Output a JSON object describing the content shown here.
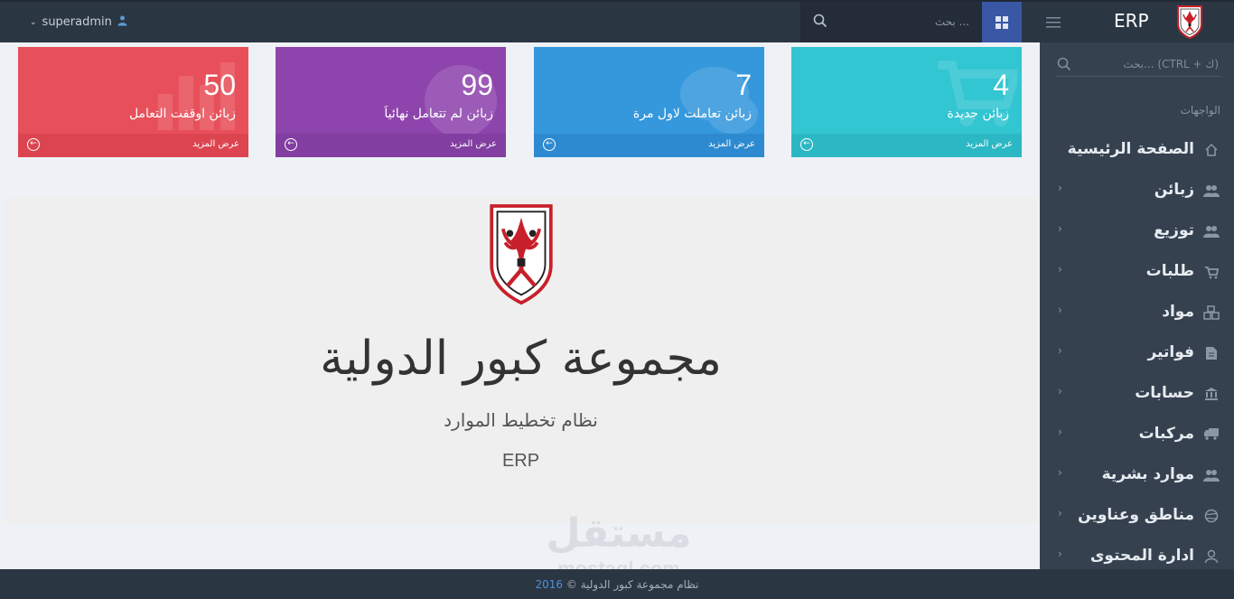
{
  "header": {
    "brand": "ERP",
    "user": "superadmin",
    "search_placeholder": "بحث ..."
  },
  "sidebar": {
    "search_placeholder": "بحث... (CTRL + ك)",
    "heading": "الواجهات",
    "items": [
      {
        "label": "الصفحة الرئيسية",
        "icon": "home-icon",
        "has_arrow": false
      },
      {
        "label": "زبائن",
        "icon": "users-icon",
        "has_arrow": true
      },
      {
        "label": "توزيع",
        "icon": "users-icon",
        "has_arrow": true
      },
      {
        "label": "طلبات",
        "icon": "cart-icon",
        "has_arrow": true
      },
      {
        "label": "مواد",
        "icon": "cubes-icon",
        "has_arrow": true
      },
      {
        "label": "فواتير",
        "icon": "file-icon",
        "has_arrow": true
      },
      {
        "label": "حسابات",
        "icon": "bank-icon",
        "has_arrow": true
      },
      {
        "label": "مركبات",
        "icon": "truck-icon",
        "has_arrow": true
      },
      {
        "label": "موارد بشرية",
        "icon": "users-icon",
        "has_arrow": true
      },
      {
        "label": "مناطق وعناوين",
        "icon": "globe-icon",
        "has_arrow": true
      },
      {
        "label": "ادارة المحتوى",
        "icon": "user-icon",
        "has_arrow": true
      }
    ]
  },
  "tiles": [
    {
      "number": "4",
      "label": "زبائن جديدة",
      "more": "عرض المزيد",
      "color": "#32c5d2"
    },
    {
      "number": "7",
      "label": "زبائن تعاملت لاول مرة",
      "more": "عرض المزيد",
      "color": "#3598dc"
    },
    {
      "number": "99",
      "label": "زبائن لم تتعامل نهائياَ",
      "more": "عرض المزيد",
      "color": "#8e44ad"
    },
    {
      "number": "50",
      "label": "زبائن اوقفت التعامل",
      "more": "عرض المزيد",
      "color": "#e7505a"
    }
  ],
  "main": {
    "company_name": "مجموعة كبور الدولية",
    "subtitle": "نظام تخطيط الموارد",
    "erp": "ERP"
  },
  "watermark": {
    "arabic": "مستقل",
    "english": "mostaql.com"
  },
  "footer": {
    "text": "نظام مجموعة كبور الدولية ©",
    "year": "2016"
  }
}
